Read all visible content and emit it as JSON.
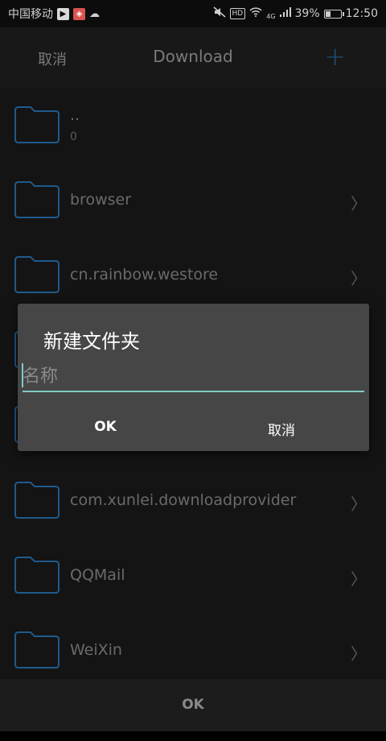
{
  "status_bar": {
    "carrier": "中国移动",
    "network": "4G",
    "hd_badge": "HD",
    "battery_percent": "39%",
    "battery_level": 0.39,
    "time": "12:50",
    "icons": [
      "play-icon",
      "app-red-icon",
      "cloud-icon",
      "mute-icon",
      "wifi-icon",
      "signal-icon",
      "battery-icon"
    ]
  },
  "header": {
    "cancel_label": "取消",
    "title": "Download",
    "add_label": "+"
  },
  "list": {
    "items": [
      {
        "name": "..",
        "sub": "0"
      },
      {
        "name": "browser"
      },
      {
        "name": "cn.rainbow.westore"
      },
      {
        "name": ""
      },
      {
        "name": ""
      },
      {
        "name": "com.xunlei.downloadprovider"
      },
      {
        "name": "QQMail"
      },
      {
        "name": "WeiXin"
      }
    ]
  },
  "dialog": {
    "title": "新建文件夹",
    "input_placeholder": "名称",
    "input_value": "",
    "ok_label": "OK",
    "cancel_label": "取消"
  },
  "bottom": {
    "ok_label": "OK"
  },
  "colors": {
    "folder_stroke": "#1e5a8c",
    "accent_underline": "#80cbc4",
    "dialog_bg": "#464646"
  }
}
